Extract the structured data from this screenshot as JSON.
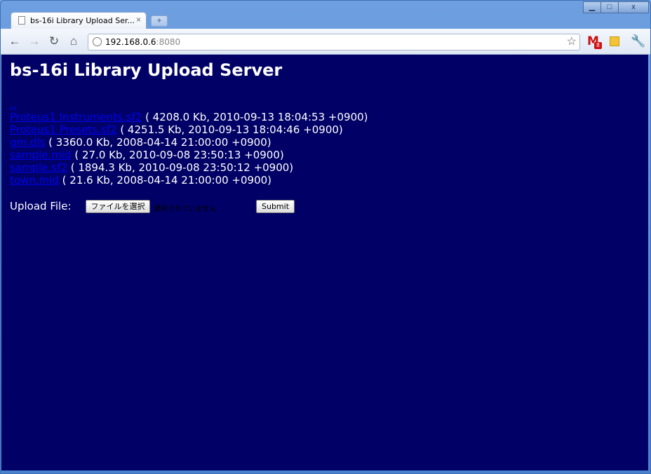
{
  "browser": {
    "tab_title": "bs-16i Library Upload Ser...",
    "tab_close": "×",
    "new_tab": "+",
    "window_controls": {
      "minimize": "▁",
      "maximize": "□",
      "close": "x"
    },
    "nav": {
      "back": "←",
      "forward": "→",
      "reload": "↻",
      "home": "⌂"
    },
    "url_host": "192.168.0.6",
    "url_port": ":8080",
    "bookmark_star": "☆",
    "extensions": {
      "gmail_letter": "M",
      "gmail_count": "8",
      "wrench": "🔧"
    }
  },
  "page": {
    "title": "bs-16i Library Upload Server",
    "parent_link": "..",
    "files": [
      {
        "name": "Proteus1 Instruments.sf2",
        "info": " ( 4208.0 Kb, 2010-09-13 18:04:53 +0900)"
      },
      {
        "name": "Proteus1 Presets.sf2",
        "info": " ( 4251.5 Kb, 2010-09-13 18:04:46 +0900)"
      },
      {
        "name": "gm.dls",
        "info": " ( 3360.0 Kb, 2008-04-14 21:00:00 +0900)"
      },
      {
        "name": "sample.mid",
        "info": " ( 27.0 Kb, 2010-09-08 23:50:13 +0900)"
      },
      {
        "name": "sample.sf2",
        "info": " ( 1894.3 Kb, 2010-09-08 23:50:12 +0900)"
      },
      {
        "name": "town.mid",
        "info": " ( 21.6 Kb, 2008-04-14 21:00:00 +0900)"
      }
    ],
    "upload": {
      "label": "Upload File:",
      "choose_button": "ファイルを選択",
      "no_file": "選択されていません",
      "submit": "Submit"
    }
  },
  "colors": {
    "page_background": "#000066",
    "link": "#0000ee",
    "text": "#ffffff"
  }
}
